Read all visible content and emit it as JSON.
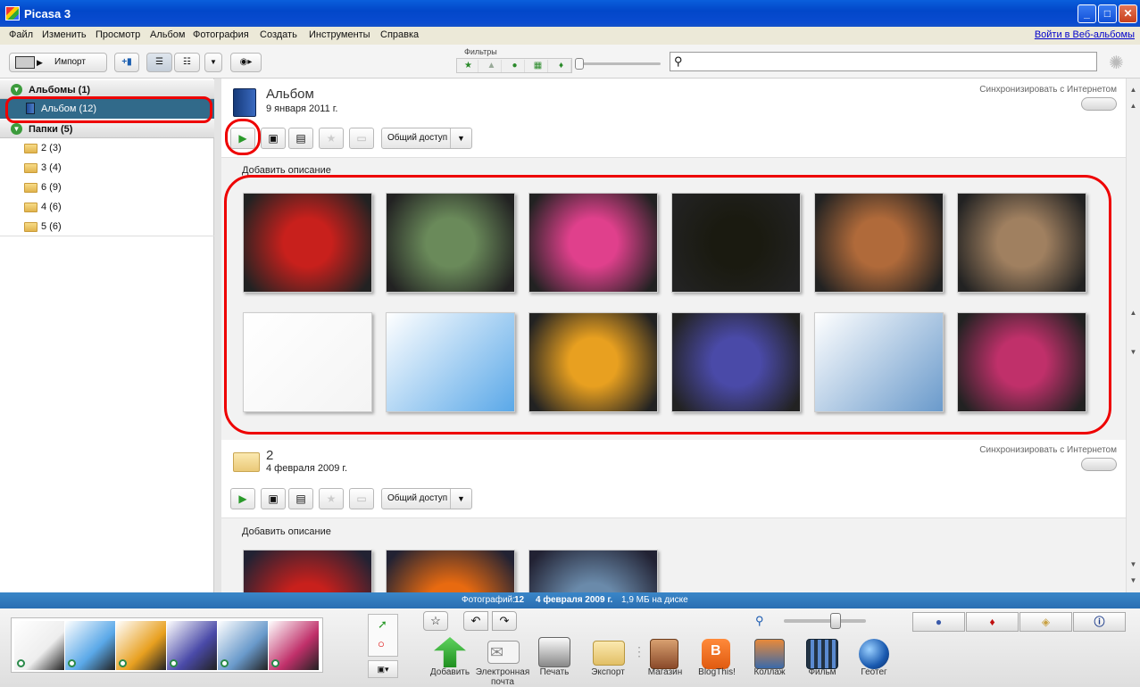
{
  "window": {
    "title": "Picasa 3",
    "controls": [
      "_",
      "□",
      "✕"
    ]
  },
  "menu": {
    "items": [
      "Файл",
      "Изменить",
      "Просмотр",
      "Альбом",
      "Фотография",
      "Создать",
      "Инструменты",
      "Справка"
    ],
    "web_link": "Войти в Веб-альбомы"
  },
  "toolbar": {
    "import_label": "Импорт",
    "filters_label": "Фильтры",
    "search_placeholder": ""
  },
  "sidebar": {
    "albums_header": "Альбомы (1)",
    "album_item": "Альбом (12)",
    "folders_header": "Папки (5)",
    "folders": [
      "2 (3)",
      "3 (4)",
      "6 (9)",
      "4 (6)",
      "5 (6)"
    ]
  },
  "sections": [
    {
      "title": "Альбом",
      "date": "9 января 2011 г.",
      "sync": "Синхронизировать с Интернетом",
      "share": "Общий доступ",
      "add_desc": "Добавить описание",
      "thumbs": [
        "#c8201c",
        "#6a8a5a",
        "#e0408c",
        "#1a1a10",
        "#b06a3a",
        "#a08060",
        "#f4f4f4",
        "#5aa8e8",
        "#e8a020",
        "#4a4aa8",
        "#6a9acb",
        "#c0306a"
      ]
    },
    {
      "title": "2",
      "date": "4 февраля 2009 г.",
      "sync": "Синхронизировать с Интернетом",
      "share": "Общий доступ",
      "add_desc": "Добавить описание",
      "thumbs": [
        "#c8201c",
        "#e86a10",
        "#6a8aaa"
      ]
    }
  ],
  "status": {
    "photos_label": "Фотографий:",
    "photos_count": "12",
    "date": "4 февраля 2009 г.",
    "size": "1,9 МБ на диске"
  },
  "bottom": {
    "tray_thumbs": [
      "#eeeeee",
      "#5aa8e8",
      "#e8a020",
      "#4a4aa8",
      "#6a9acb",
      "#c0306a"
    ],
    "actions": [
      "Добавить",
      "Электронная почта",
      "Печать",
      "Экспорт",
      "Магазин",
      "BlogThis!",
      "Коллаж",
      "Фильм",
      "Геотег"
    ]
  },
  "colors": {
    "accent": "#316a8a",
    "status": "#2a6fb2",
    "annotation": "#e00000"
  }
}
